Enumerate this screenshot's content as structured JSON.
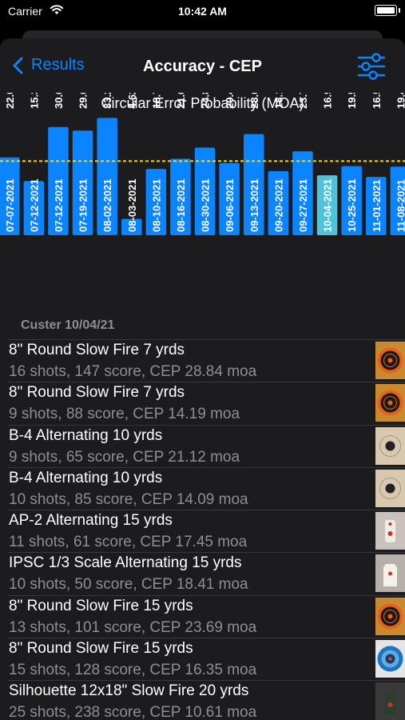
{
  "status": {
    "carrier": "Carrier",
    "time": "10:42 AM"
  },
  "nav": {
    "back_label": "Results",
    "title": "Accuracy - CEP"
  },
  "colors": {
    "accent": "#0a84ff",
    "highlight": "#4fc3d9",
    "average_line": "#ffd60a",
    "background": "#1c1c1e"
  },
  "chart_data": {
    "type": "bar",
    "title": "Circular Error Probability (MOA)",
    "categories": [
      "07-07-2021",
      "07-12-2021",
      "07-12-2021",
      "07-19-2021",
      "08-02-2021",
      "08-03-2021",
      "08-10-2021",
      "08-16-2021",
      "08-30-2021",
      "09-06-2021",
      "09-13-2021",
      "09-20-2021",
      "09-27-2021",
      "10-04-2021",
      "10-25-2021",
      "11-01-2021",
      "11-08-2021"
    ],
    "values": [
      22.04,
      15.32,
      30.66,
      29.65,
      33.23,
      4.62,
      18.78,
      21.66,
      24.83,
      20.42,
      28.65,
      18.16,
      23.76,
      16.96,
      19.59,
      16.52,
      19.44
    ],
    "highlighted_index": 13,
    "average_line": 21,
    "ylim": [
      0,
      34
    ]
  },
  "section": {
    "header": "Custer 10/04/21"
  },
  "rows": [
    {
      "title": "8\" Round Slow Fire 7 yrds",
      "subtitle": "16 shots, 147 score, CEP 28.84 moa",
      "thumb": "orange-round-target"
    },
    {
      "title": "8\" Round Slow Fire 7 yrds",
      "subtitle": "9 shots, 88 score, CEP 14.19 moa",
      "thumb": "orange-round-target"
    },
    {
      "title": "B-4 Alternating 10 yrds",
      "subtitle": "9 shots, 65 score, CEP 21.12 moa",
      "thumb": "beige-bullseye-target"
    },
    {
      "title": "B-4 Alternating 10 yrds",
      "subtitle": "10 shots, 85 score, CEP 14.09 moa",
      "thumb": "beige-bullseye-target"
    },
    {
      "title": "AP-2 Alternating 15 yrds",
      "subtitle": "11 shots, 61 score, CEP 17.45 moa",
      "thumb": "paper-silhouette-target"
    },
    {
      "title": "IPSC 1/3 Scale Alternating 15 yrds",
      "subtitle": "10 shots, 50 score, CEP 18.41 moa",
      "thumb": "ipsc-target"
    },
    {
      "title": "8\" Round Slow Fire 15 yrds",
      "subtitle": "13 shots, 101 score, CEP 23.69 moa",
      "thumb": "orange-round-target"
    },
    {
      "title": "8\" Round Slow Fire 15 yrds",
      "subtitle": "15 shots, 128 score, CEP 16.35 moa",
      "thumb": "blue-round-target"
    },
    {
      "title": "Silhouette 12x18\" Slow Fire 20 yrds",
      "subtitle": "25 shots, 238 score, CEP 10.61 moa",
      "thumb": "steel-silhouette-target"
    }
  ]
}
